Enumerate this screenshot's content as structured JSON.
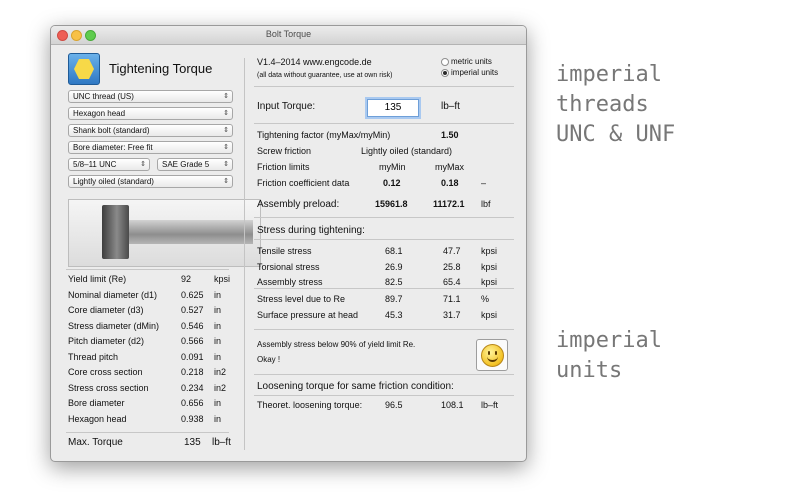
{
  "window": {
    "title": "Bolt Torque"
  },
  "app": {
    "title": "Tightening Torque",
    "version": "V1.4–2014 www.engcode.de",
    "disclaimer": "(all data without guarantee, use at own risk)"
  },
  "units": {
    "metric": "metric units",
    "imperial": "imperial units",
    "selected": "imperial"
  },
  "popups": {
    "thread": "UNC thread (US)",
    "head": "Hexagon head",
    "bolt": "Shank bolt (standard)",
    "bore": "Bore diameter: Free fit",
    "size": "5/8–11 UNC",
    "grade": "SAE Grade 5",
    "friction": "Lightly oiled (standard)"
  },
  "props": [
    {
      "label": "Yield limit (Re)",
      "value": "92",
      "unit": "kpsi"
    },
    {
      "label": "Nominal diameter (d1)",
      "value": "0.625",
      "unit": "in"
    },
    {
      "label": "Core diameter (d3)",
      "value": "0.527",
      "unit": "in"
    },
    {
      "label": "Stress diameter (dMin)",
      "value": "0.546",
      "unit": "in"
    },
    {
      "label": "Pitch diameter (d2)",
      "value": "0.566",
      "unit": "in"
    },
    {
      "label": "Thread pitch",
      "value": "0.091",
      "unit": "in"
    },
    {
      "label": "Core cross section",
      "value": "0.218",
      "unit": "in2"
    },
    {
      "label": "Stress cross section",
      "value": "0.234",
      "unit": "in2"
    },
    {
      "label": "Bore diameter",
      "value": "0.656",
      "unit": "in"
    },
    {
      "label": "Hexagon head",
      "value": "0.938",
      "unit": "in"
    }
  ],
  "max_torque": {
    "label": "Max. Torque",
    "value": "135",
    "unit": "lb–ft"
  },
  "input_torque": {
    "label": "Input Torque:",
    "value": "135",
    "unit": "lb–ft"
  },
  "factors": {
    "tightening_label": "Tightening factor (myMax/myMin)",
    "tightening_value": "1.50",
    "screw_friction_label": "Screw friction",
    "screw_friction_value": "Lightly oiled (standard)",
    "limits_label": "Friction limits",
    "limits_min": "myMin",
    "limits_max": "myMax",
    "coeff_label": "Friction coefficient data",
    "coeff_min": "0.12",
    "coeff_max": "0.18",
    "coeff_unit": "–"
  },
  "preload": {
    "label": "Assembly preload:",
    "min": "15961.8",
    "max": "11172.1",
    "unit": "lbf"
  },
  "stress_heading": "Stress during tightening:",
  "stress_a": [
    {
      "label": "Tensile stress",
      "min": "68.1",
      "max": "47.7",
      "unit": "kpsi"
    },
    {
      "label": "Torsional stress",
      "min": "26.9",
      "max": "25.8",
      "unit": "kpsi"
    },
    {
      "label": "Assembly stress",
      "min": "82.5",
      "max": "65.4",
      "unit": "kpsi"
    }
  ],
  "stress_b": [
    {
      "label": "Stress level due to Re",
      "min": "89.7",
      "max": "71.1",
      "unit": "%"
    },
    {
      "label": "Surface pressure at head",
      "min": "45.3",
      "max": "31.7",
      "unit": "kpsi"
    }
  ],
  "message": {
    "line1": "Assembly stress below 90% of yield limit Re.",
    "line2": "Okay !"
  },
  "loosening": {
    "heading": "Loosening torque for same friction condition:",
    "label": "Theoret. loosening torque:",
    "min": "96.5",
    "max": "108.1",
    "unit": "lb–ft"
  },
  "side_text": {
    "block1": [
      "imperial",
      "threads",
      "UNC & UNF"
    ],
    "block2": [
      "imperial",
      "units"
    ]
  }
}
